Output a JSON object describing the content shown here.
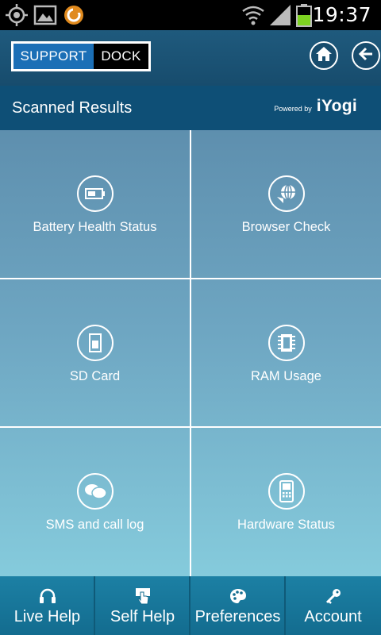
{
  "status_bar": {
    "time": "19:37",
    "icons": [
      "gps-icon",
      "gallery-icon",
      "app-notification-icon",
      "wifi-icon",
      "signal-icon",
      "battery-icon"
    ]
  },
  "header": {
    "logo": {
      "left": "SUPPORT",
      "right": "DOCK"
    },
    "home_icon": "home-icon",
    "back_icon": "back-arrow-icon"
  },
  "title_bar": {
    "title": "Scanned Results",
    "powered_by": "Powered by",
    "brand": "iYogi"
  },
  "tiles": [
    {
      "label": "Battery Health Status",
      "icon": "battery-icon"
    },
    {
      "label": "Browser Check",
      "icon": "globe-icon"
    },
    {
      "label": "SD Card",
      "icon": "sd-card-icon"
    },
    {
      "label": "RAM Usage",
      "icon": "ram-chip-icon"
    },
    {
      "label": "SMS and call log",
      "icon": "chat-bubbles-icon"
    },
    {
      "label": "Hardware Status",
      "icon": "phone-device-icon"
    }
  ],
  "bottom_nav": [
    {
      "label": "Live Help",
      "icon": "headset-icon"
    },
    {
      "label": "Self Help",
      "icon": "pointer-hand-icon"
    },
    {
      "label": "Preferences",
      "icon": "palette-icon"
    },
    {
      "label": "Account",
      "icon": "key-icon"
    }
  ],
  "colors": {
    "header": "#174c6d",
    "title_bar": "#0e4f76",
    "grid_top": "#5e8fae",
    "grid_bottom": "#85cbdc",
    "bottom_nav": "#1c80a4",
    "logo_blue": "#1b6fb6"
  }
}
